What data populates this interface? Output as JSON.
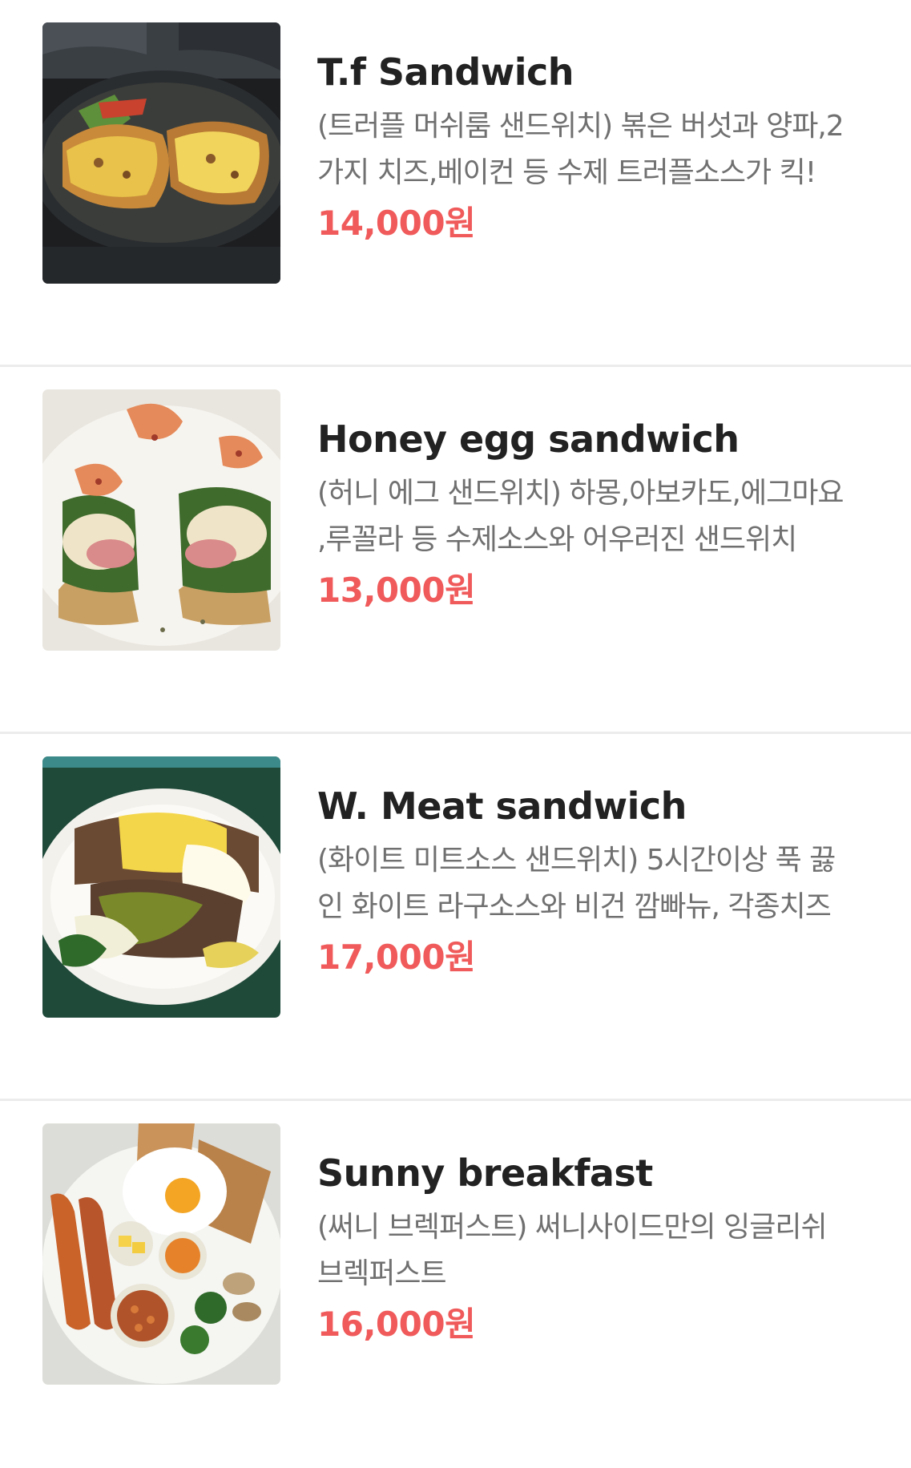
{
  "menu": {
    "items": [
      {
        "title": "T.f Sandwich",
        "description_lines": [
          "(트러플 머쉬룸 샌드위치) 볶은 버섯과 양파,2",
          "가지 치즈,베이컨 등 수제 트러플소스가 킥!"
        ],
        "price": "14,000원"
      },
      {
        "title": "Honey egg sandwich",
        "description_lines": [
          "(허니 에그 샌드위치) 하몽,아보카도,에그마요",
          ",루꼴라 등 수제소스와 어우러진 샌드위치"
        ],
        "price": "13,000원"
      },
      {
        "title": "W. Meat sandwich",
        "description_lines": [
          "(화이트 미트소스 샌드위치) 5시간이상 푹 끓",
          "인 화이트 라구소스와 비건 깜빠뉴, 각종치즈"
        ],
        "price": "17,000원"
      },
      {
        "title": "Sunny breakfast",
        "description_lines": [
          "(써니 브렉퍼스트) 써니사이드만의 잉글리쉬",
          "브렉퍼스트"
        ],
        "price": "16,000원"
      }
    ]
  },
  "colors": {
    "title": "#222222",
    "description": "#707070",
    "price": "#f05a5a",
    "divider": "#ececec"
  }
}
